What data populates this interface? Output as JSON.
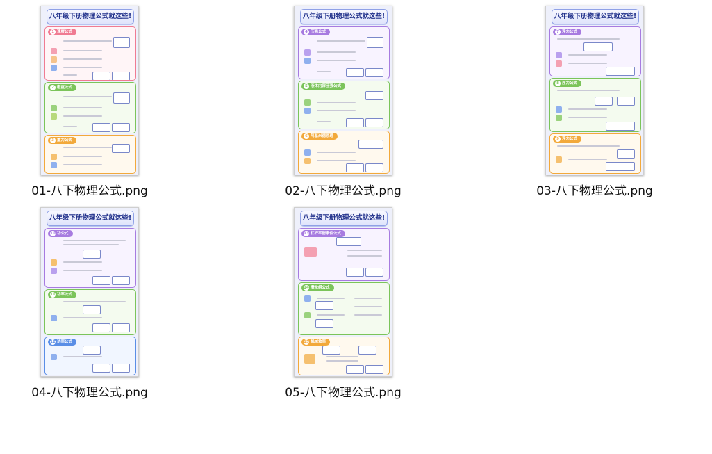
{
  "files": [
    {
      "name": "01-八下物理公式.png",
      "poster_title": "八年级下册物理公式就这些!",
      "sections": [
        {
          "num": "1",
          "label": "速度公式"
        },
        {
          "num": "2",
          "label": "密度公式"
        },
        {
          "num": "3",
          "label": "重力公式"
        }
      ]
    },
    {
      "name": "02-八下物理公式.png",
      "poster_title": "八年级下册物理公式就这些!",
      "sections": [
        {
          "num": "4",
          "label": "压强公式"
        },
        {
          "num": "5",
          "label": "液体内部压强公式"
        },
        {
          "num": "6",
          "label": "阿基米德原理"
        }
      ]
    },
    {
      "name": "03-八下物理公式.png",
      "poster_title": "八年级下册物理公式就这些!",
      "sections": [
        {
          "num": "7",
          "label": "浮力公式"
        },
        {
          "num": "8",
          "label": "浮力公式"
        },
        {
          "num": "9",
          "label": "浮力公式"
        }
      ]
    },
    {
      "name": "04-八下物理公式.png",
      "poster_title": "八年级下册物理公式就这些!",
      "sections": [
        {
          "num": "10",
          "label": "功公式"
        },
        {
          "num": "11",
          "label": "功率公式"
        },
        {
          "num": "12",
          "label": "功率公式"
        }
      ]
    },
    {
      "name": "05-八下物理公式.png",
      "poster_title": "八年级下册物理公式就这些!",
      "sections": [
        {
          "num": "13",
          "label": "杠杆平衡条件公式"
        },
        {
          "num": "14",
          "label": "滑轮组公式"
        },
        {
          "num": "15",
          "label": "机械效率"
        }
      ]
    }
  ],
  "colors": {
    "pink": "#f07b92",
    "green": "#7bc45a",
    "yellow": "#f2a93b",
    "blue": "#5a8ee6",
    "purple": "#a77be0",
    "title": "#1f2f8a"
  }
}
